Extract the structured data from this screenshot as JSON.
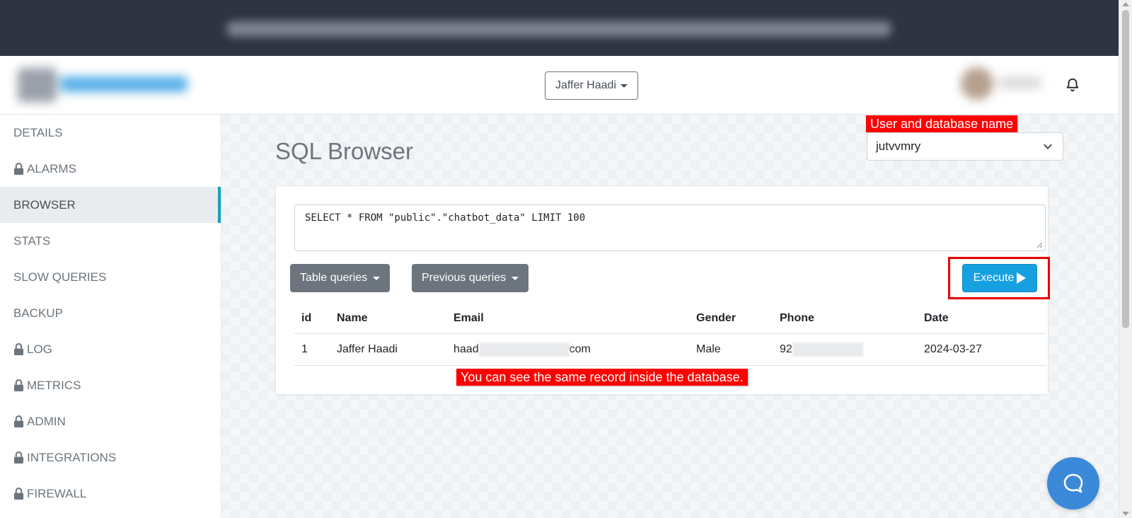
{
  "header": {
    "user_dropdown_label": "Jaffer Haadi"
  },
  "sidebar": {
    "items": [
      {
        "label": "DETAILS",
        "locked": false,
        "active": false
      },
      {
        "label": "ALARMS",
        "locked": true,
        "active": false
      },
      {
        "label": "BROWSER",
        "locked": false,
        "active": true
      },
      {
        "label": "STATS",
        "locked": false,
        "active": false
      },
      {
        "label": "SLOW QUERIES",
        "locked": false,
        "active": false
      },
      {
        "label": "BACKUP",
        "locked": false,
        "active": false
      },
      {
        "label": "LOG",
        "locked": true,
        "active": false
      },
      {
        "label": "METRICS",
        "locked": true,
        "active": false
      },
      {
        "label": "ADMIN",
        "locked": true,
        "active": false
      },
      {
        "label": "INTEGRATIONS",
        "locked": true,
        "active": false
      },
      {
        "label": "FIREWALL",
        "locked": true,
        "active": false
      }
    ]
  },
  "main": {
    "title": "SQL Browser",
    "database_select_value": "jutvvmry",
    "query_text": "SELECT * FROM \"public\".\"chatbot_data\" LIMIT 100",
    "table_queries_label": "Table queries",
    "previous_queries_label": "Previous queries",
    "execute_label": "Execute",
    "results": {
      "columns": [
        "id",
        "Name",
        "Email",
        "Gender",
        "Phone",
        "Date"
      ],
      "rows": [
        {
          "id": "1",
          "name": "Jaffer Haadi",
          "email_prefix": "haad",
          "email_suffix": "com",
          "gender": "Male",
          "phone_prefix": "92",
          "date": "2024-03-27"
        }
      ]
    }
  },
  "annotations": {
    "db_note": "User and database name",
    "record_note": "You can see the same record inside the database."
  },
  "colors": {
    "accent": "#17a2b8",
    "execute": "#17a0e0",
    "annotation": "#ff0000",
    "chat": "#3a8ad9"
  },
  "icons": [
    "bell-icon",
    "lock-icon",
    "chevron-down-icon",
    "play-icon",
    "chat-icon"
  ]
}
